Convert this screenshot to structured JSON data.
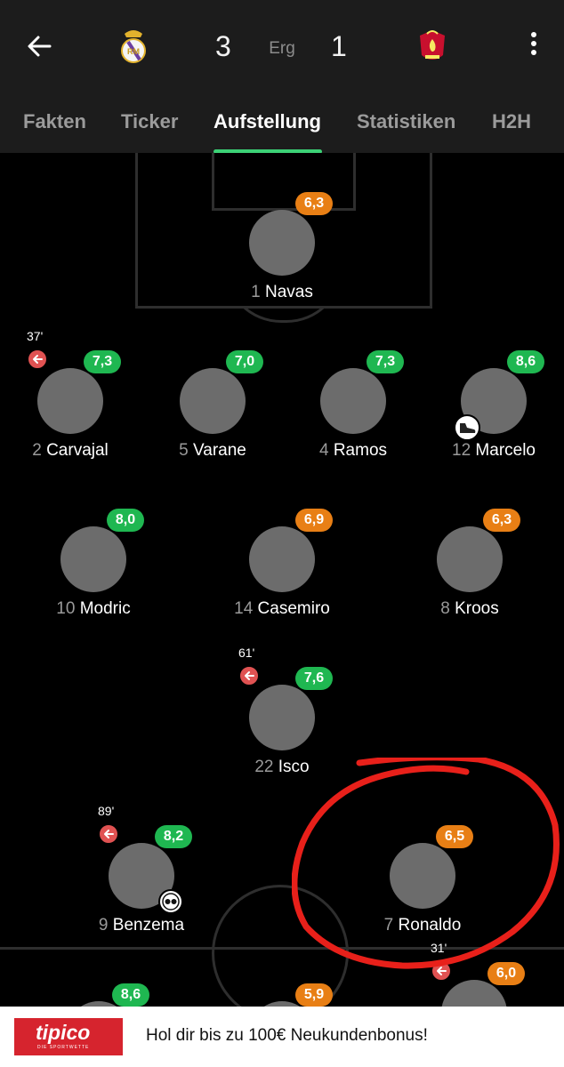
{
  "match": {
    "home_score": "3",
    "status": "Erg",
    "away_score": "1",
    "home_crest": "real-madrid-crest",
    "away_crest": "liverpool-crest"
  },
  "tabs": [
    {
      "label": "Fakten"
    },
    {
      "label": "Ticker"
    },
    {
      "label": "Aufstellung",
      "active": true
    },
    {
      "label": "Statistiken"
    },
    {
      "label": "H2H"
    }
  ],
  "lineup": [
    {
      "number": "1",
      "name": "Navas",
      "rating": "6,3",
      "rating_color": "orange"
    },
    {
      "number": "2",
      "name": "Carvajal",
      "rating": "7,3",
      "rating_color": "green",
      "sub_minute": "37'"
    },
    {
      "number": "5",
      "name": "Varane",
      "rating": "7,0",
      "rating_color": "green"
    },
    {
      "number": "4",
      "name": "Ramos",
      "rating": "7,3",
      "rating_color": "green"
    },
    {
      "number": "12",
      "name": "Marcelo",
      "rating": "8,6",
      "rating_color": "green",
      "event": "boot-icon"
    },
    {
      "number": "10",
      "name": "Modric",
      "rating": "8,0",
      "rating_color": "green"
    },
    {
      "number": "14",
      "name": "Casemiro",
      "rating": "6,9",
      "rating_color": "orange"
    },
    {
      "number": "8",
      "name": "Kroos",
      "rating": "6,3",
      "rating_color": "orange"
    },
    {
      "number": "22",
      "name": "Isco",
      "rating": "7,6",
      "rating_color": "green",
      "sub_minute": "61'"
    },
    {
      "number": "9",
      "name": "Benzema",
      "rating": "8,2",
      "rating_color": "green",
      "sub_minute": "89'",
      "event": "ball-icon"
    },
    {
      "number": "7",
      "name": "Ronaldo",
      "rating": "6,5",
      "rating_color": "orange"
    }
  ],
  "bottom_row": [
    {
      "rating": "8,6",
      "rating_color": "green"
    },
    {
      "rating": "5,9",
      "rating_color": "orange"
    },
    {
      "rating": "6,0",
      "rating_color": "orange",
      "sub_minute": "31'"
    }
  ],
  "ad": {
    "logo_text": "tipico",
    "logo_sub": "DIE SPORTWETTE",
    "text": "Hol dir bis zu 100€ Neukundenbonus!"
  },
  "colors": {
    "rating_green": "#1fb751",
    "rating_orange": "#e87f15",
    "tab_indicator": "#3cd176",
    "sub_icon": "#e05252",
    "annotation_red": "#e8201a",
    "ad_brand": "#d6242e"
  }
}
